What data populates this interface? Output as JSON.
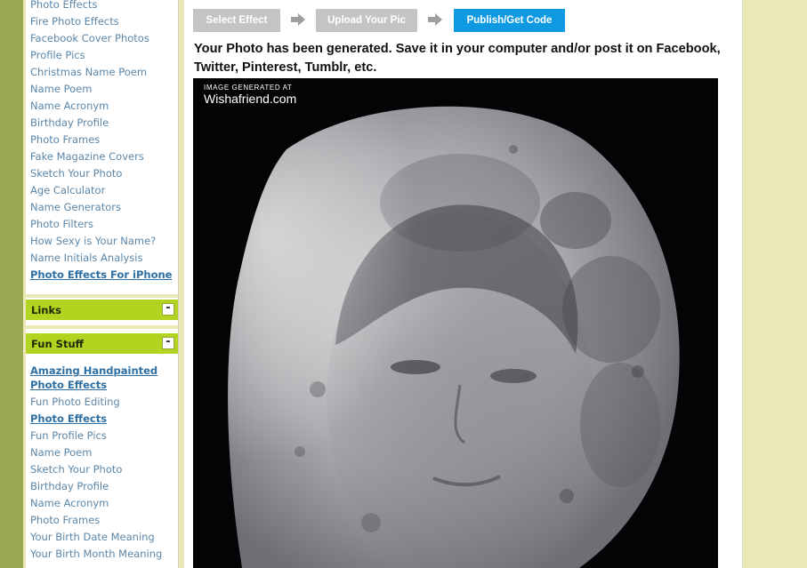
{
  "sidebar": {
    "top_links": [
      {
        "label": "Photo Effects",
        "bold": false
      },
      {
        "label": "Fire Photo Effects",
        "bold": false
      },
      {
        "label": "Facebook Cover Photos",
        "bold": false
      },
      {
        "label": "Profile Pics",
        "bold": false
      },
      {
        "label": "Christmas Name Poem",
        "bold": false
      },
      {
        "label": "Name Poem",
        "bold": false
      },
      {
        "label": "Name Acronym",
        "bold": false
      },
      {
        "label": "Birthday Profile",
        "bold": false
      },
      {
        "label": "Photo Frames",
        "bold": false
      },
      {
        "label": "Fake Magazine Covers",
        "bold": false
      },
      {
        "label": "Sketch Your Photo",
        "bold": false
      },
      {
        "label": "Age Calculator",
        "bold": false
      },
      {
        "label": "Name Generators",
        "bold": false
      },
      {
        "label": "Photo Filters",
        "bold": false
      },
      {
        "label": "How Sexy is Your Name?",
        "bold": false
      },
      {
        "label": "Name Initials Analysis",
        "bold": false
      },
      {
        "label": "Photo Effects For iPhone",
        "bold": true
      }
    ],
    "links_panel": {
      "title": "Links",
      "toggle": "-"
    },
    "fun_panel": {
      "title": "Fun Stuff",
      "toggle": "-",
      "links": [
        {
          "label": "Amazing Handpainted",
          "bold": true
        },
        {
          "label": "Photo Effects",
          "bold": true
        },
        {
          "label": "Fun Photo Editing",
          "bold": false
        },
        {
          "label": "Photo Effects",
          "bold": true
        },
        {
          "label": "Fun Profile Pics",
          "bold": false
        },
        {
          "label": "Name Poem",
          "bold": false
        },
        {
          "label": "Sketch Your Photo",
          "bold": false
        },
        {
          "label": "Birthday Profile",
          "bold": false
        },
        {
          "label": "Name Acronym",
          "bold": false
        },
        {
          "label": "Photo Frames",
          "bold": false
        },
        {
          "label": "Your Birth Date Meaning",
          "bold": false
        },
        {
          "label": "Your Birth Month Meaning",
          "bold": false
        }
      ]
    }
  },
  "steps": [
    {
      "label": "Select Effect",
      "active": false
    },
    {
      "label": "Upload Your Pic",
      "active": false
    },
    {
      "label": "Publish/Get Code",
      "active": true
    }
  ],
  "main": {
    "headline": "Your Photo has been generated. Save it in your computer and/or post it on Facebook, Twitter, Pinterest, Tumblr, etc.",
    "watermark_small": "IMAGE GENERATED AT",
    "watermark_big": "Wishafriend.com"
  },
  "colors": {
    "page_bg": "#e9e8b6",
    "sidebar_header": "#b2d320",
    "link": "#5b86a8",
    "active_step": "#0e9ae3",
    "inactive_step": "#c4c4c4"
  },
  "icons": [
    "arrow-right-icon",
    "minus-icon"
  ]
}
